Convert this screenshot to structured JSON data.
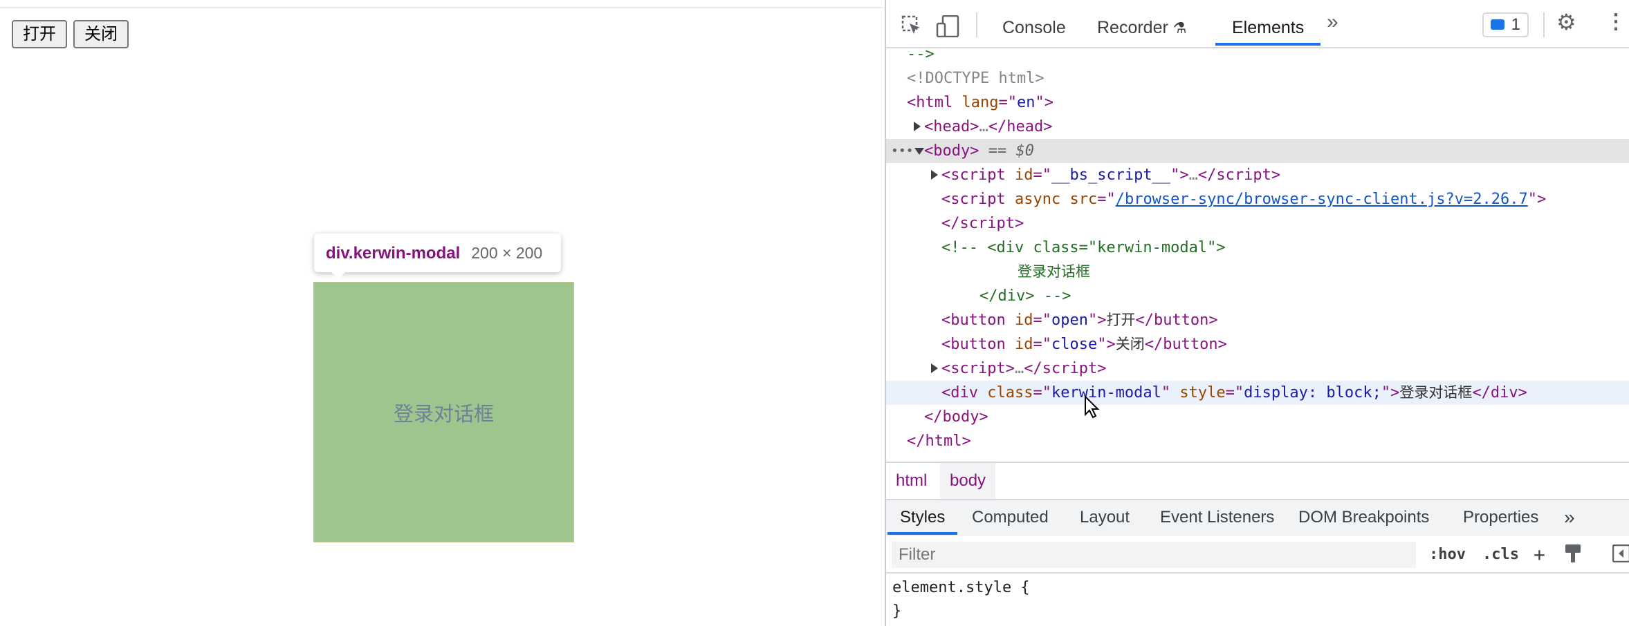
{
  "page": {
    "open_button": "打开",
    "close_button": "关闭",
    "modal_text": "登录对话框",
    "tooltip": {
      "selector": "div.kerwin-modal",
      "dims": "200 × 200"
    }
  },
  "devtools": {
    "tabs": [
      "Console",
      "Recorder",
      "Elements"
    ],
    "active_tab": "Elements",
    "issues_count": "1",
    "dom": {
      "l0": "-->",
      "l1": "<!DOCTYPE html>",
      "l2_tag": "html",
      "l2_attr": "lang",
      "l2_val": "en",
      "l3": "head",
      "l4_tag": "body",
      "l4_eq": "== $0",
      "l5_attr": "id",
      "l5_val": "__bs_script__",
      "l6_attr1": "async",
      "l6_attr2": "src",
      "l6_val": "/browser-sync/browser-sync-client.js?v=2.26.7",
      "l7": "script",
      "l8": "<!-- <div class=\"kerwin-modal\">",
      "l9": "登录对话框",
      "l10": "</div> -->",
      "l11_attr": "id",
      "l11_val": "open",
      "l11_text": "打开",
      "l12_attr": "id",
      "l12_val": "close",
      "l12_text": "关闭",
      "l13": "script",
      "l14_attr1": "class",
      "l14_val1": "kerwin-modal",
      "l14_attr2": "style",
      "l14_val2": "display: block;",
      "l14_text": "登录对话框",
      "l15": "body",
      "l16": "html"
    },
    "breadcrumbs": [
      "html",
      "body"
    ],
    "bottom_tabs": [
      "Styles",
      "Computed",
      "Layout",
      "Event Listeners",
      "DOM Breakpoints",
      "Properties"
    ],
    "filter_placeholder": "Filter",
    "hov": ":hov",
    "cls": ".cls",
    "element_style_open": "element.style {",
    "element_style_close": "}"
  },
  "colors": {
    "modal_bg": "#9fc58e",
    "accent": "#1a73e8",
    "tag": "#881280"
  }
}
